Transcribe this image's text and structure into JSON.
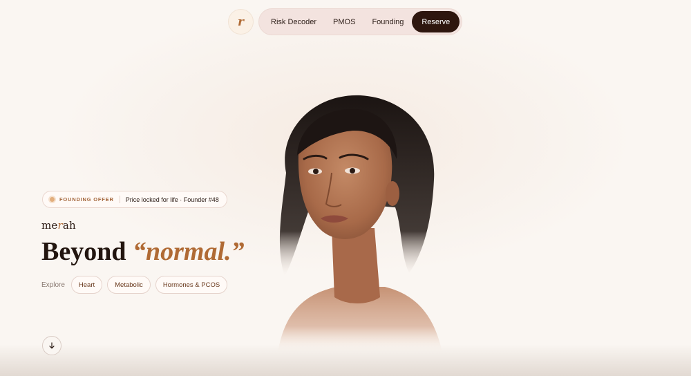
{
  "nav": {
    "logo_letter": "r",
    "items": [
      {
        "label": "Risk Decoder"
      },
      {
        "label": "PMOS"
      },
      {
        "label": "Founding"
      }
    ],
    "cta_label": "Reserve"
  },
  "hero": {
    "offer": {
      "tag": "FOUNDING OFFER",
      "text": "Price locked for life · Founder #48"
    },
    "wordmark": {
      "pre": "me",
      "accent": "r",
      "post": "ah"
    },
    "headline": {
      "plain": "Beyond",
      "accent": "“normal.”"
    },
    "explore": {
      "label": "Explore",
      "chips": [
        "Heart",
        "Metabolic",
        "Hormones & PCOS"
      ]
    },
    "scroll_icon": "arrow-down-icon",
    "portrait_alt": "portrait photo"
  },
  "colors": {
    "accent": "#b06a34",
    "cta_bg": "#2e160e",
    "background": "#faf6f2"
  }
}
